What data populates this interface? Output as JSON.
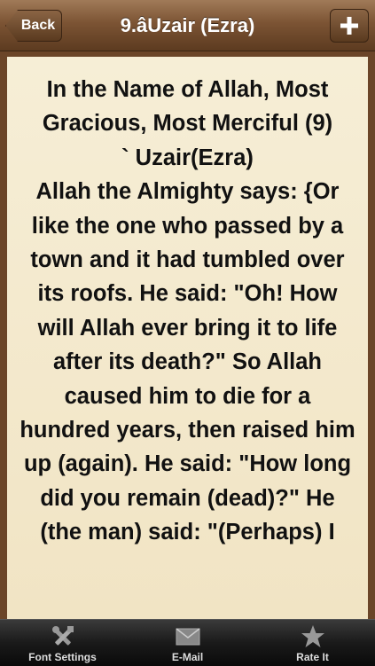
{
  "navbar": {
    "back_label": "Back",
    "title": "9.âUzair (Ezra)",
    "add_icon": "plus-icon"
  },
  "content": {
    "text": "In the Name of Allah, Most Gracious, Most Merciful (9)\n` Uzair(Ezra)\nAllah the Almighty says: {Or like the one who passed by a town and it had tumbled over its roofs. He said: \"Oh! How will Allah ever bring it to life after its death?\" So Allah caused him to die for a hundred years, then raised him up (again). He said: \"How long did you remain (dead)?\" He (the man) said: \"(Perhaps) I"
  },
  "tabbar": {
    "items": [
      {
        "label": "Font Settings",
        "icon": "tools-icon"
      },
      {
        "label": "E-Mail",
        "icon": "envelope-icon"
      },
      {
        "label": "Rate It",
        "icon": "star-icon"
      }
    ]
  },
  "colors": {
    "nav_brown": "#7c5434",
    "paper": "#f6eed6",
    "tabbar": "#1a1a1a"
  }
}
